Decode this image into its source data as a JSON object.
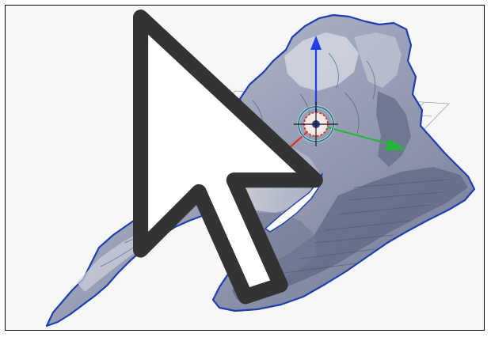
{
  "viewport": {
    "background": "#f7f7f7",
    "border": "#000000"
  },
  "mesh": {
    "outline_color": "#1f3fb0",
    "fill_color": "#8f96ad",
    "highlight_color": "#d5d8e2",
    "shadow_color": "#5d6582"
  },
  "gizmo": {
    "x_axis_color": "#e32f1f",
    "y_axis_color": "#27b43a",
    "z_axis_color": "#1f3fe8",
    "pivot_ring_color": "#2d7b94",
    "pivot_inner_color": "#c64a3a"
  },
  "grid": {
    "color": "#9a9a9a"
  },
  "cursor": {
    "icon": "mouse-pointer-icon"
  }
}
